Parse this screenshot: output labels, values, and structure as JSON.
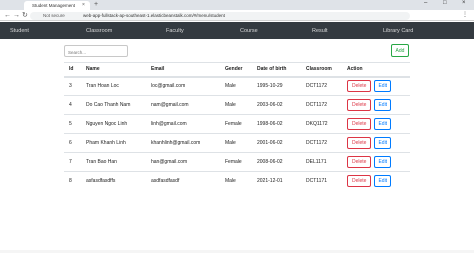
{
  "browser": {
    "tab_title": "Student Management",
    "tab_close": "×",
    "new_tab": "+",
    "min": "–",
    "max": "□",
    "close": "×",
    "back": "←",
    "forward": "→",
    "reload": "↻",
    "not_secure": "Not secure",
    "url": "web-app-fullstack-ap-southeast-1.elasticbeanstalk.com/#/menu/student",
    "menu": "⋮"
  },
  "nav": [
    "Student",
    "Classroom",
    "Faculty",
    "Course",
    "Result",
    "Library Card"
  ],
  "search": {
    "placeholder": "Search..."
  },
  "add_label": "Add",
  "table": {
    "headers": [
      "Id",
      "Name",
      "Email",
      "Gender",
      "Date of birth",
      "Classroom",
      "Action"
    ],
    "delete_label": "Delete",
    "edit_label": "Edit",
    "rows": [
      [
        "3",
        "Tran Hoan Loc",
        "loc@gmail.com",
        "Male",
        "1995-10-29",
        "DCT1172"
      ],
      [
        "4",
        "Do Cao Thanh Nam",
        "nam@gmail.com",
        "Male",
        "2003-06-02",
        "DCT1172"
      ],
      [
        "5",
        "Nguyen Ngoc Linh",
        "linh@gmail.com",
        "Female",
        "1998-06-02",
        "DKQ1172"
      ],
      [
        "6",
        "Pham Khanh Linh",
        "khanhlinh@gmail.com",
        "Male",
        "2001-06-02",
        "DCT1172"
      ],
      [
        "7",
        "Tran Bao Han",
        "han@gmail.com",
        "Female",
        "2008-06-02",
        "DEL1171"
      ],
      [
        "8",
        "asfasdfasdffs",
        "asdfasdfasdf",
        "Male",
        "2021-12-01",
        "DCT1171"
      ]
    ]
  }
}
